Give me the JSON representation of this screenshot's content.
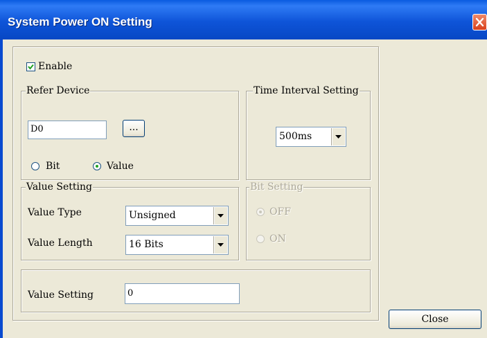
{
  "window": {
    "title": "System Power ON Setting"
  },
  "enable": {
    "label": "Enable",
    "checked": true
  },
  "refer_device": {
    "group_label": "Refer Device",
    "device_value": "D0",
    "browse_label": "...",
    "bit_label": "Bit",
    "value_label": "Value",
    "selected": "Value"
  },
  "time_interval": {
    "group_label": "Time Interval Setting",
    "selected": "500ms"
  },
  "value_setting_group": {
    "group_label": "Value Setting",
    "value_type_label": "Value Type",
    "value_type": "Unsigned",
    "value_length_label": "Value Length",
    "value_length": "16 Bits"
  },
  "bit_setting": {
    "group_label": "Bit Setting",
    "off_label": "OFF",
    "on_label": "ON",
    "selected": "OFF"
  },
  "value_setting_field": {
    "label": "Value Setting",
    "value": "0"
  },
  "close_button": {
    "label": "Close"
  }
}
